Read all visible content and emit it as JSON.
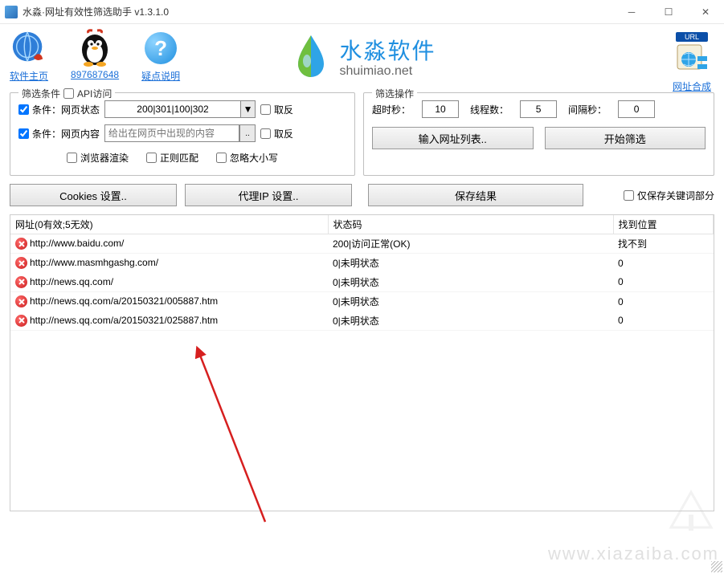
{
  "window": {
    "title": "水淼·网址有效性筛选助手 v1.3.1.0"
  },
  "toolbar": {
    "home": "软件主页",
    "qq": "897687648",
    "help": "疑点说明",
    "url_compose": "网址合成",
    "url_badge": "URL"
  },
  "brand": {
    "cn": "水淼软件",
    "en": "shuimiao.net"
  },
  "filter_cond": {
    "legend": "筛选条件",
    "api_visit": "API访问",
    "cond_pagestatus_lbl": "条件：网页状态",
    "status_value": "200|301|100|302",
    "reverse": "取反",
    "cond_pagecontent_lbl": "条件：网页内容",
    "content_placeholder": "给出在网页中出现的内容",
    "browser_render": "浏览器渲染",
    "regex": "正则匹配",
    "ignore_case": "忽略大小写"
  },
  "filter_ops": {
    "legend": "筛选操作",
    "timeout_lbl": "超时秒：",
    "timeout_val": "10",
    "threads_lbl": "线程数：",
    "threads_val": "5",
    "interval_lbl": "间隔秒：",
    "interval_val": "0",
    "input_urls": "输入网址列表..",
    "start": "开始筛选"
  },
  "mid": {
    "cookies_btn": "Cookies 设置..",
    "proxy_btn": "代理IP 设置..",
    "save_btn": "保存结果",
    "save_only_kw": "仅保存关键词部分"
  },
  "table": {
    "header_url_summary": "网址(0有效;5无效)",
    "header_status": "状态码",
    "header_pos": "找到位置",
    "rows": [
      {
        "url": "http://www.baidu.com/",
        "status": "200|访问正常(OK)",
        "pos": "找不到"
      },
      {
        "url": "http://www.masmhgashg.com/",
        "status": "0|未明状态",
        "pos": "0"
      },
      {
        "url": "http://news.qq.com/",
        "status": "0|未明状态",
        "pos": "0"
      },
      {
        "url": "http://news.qq.com/a/20150321/005887.htm",
        "status": "0|未明状态",
        "pos": "0"
      },
      {
        "url": "http://news.qq.com/a/20150321/025887.htm",
        "status": "0|未明状态",
        "pos": "0"
      }
    ]
  },
  "watermark": "www.xiazaiba.com"
}
